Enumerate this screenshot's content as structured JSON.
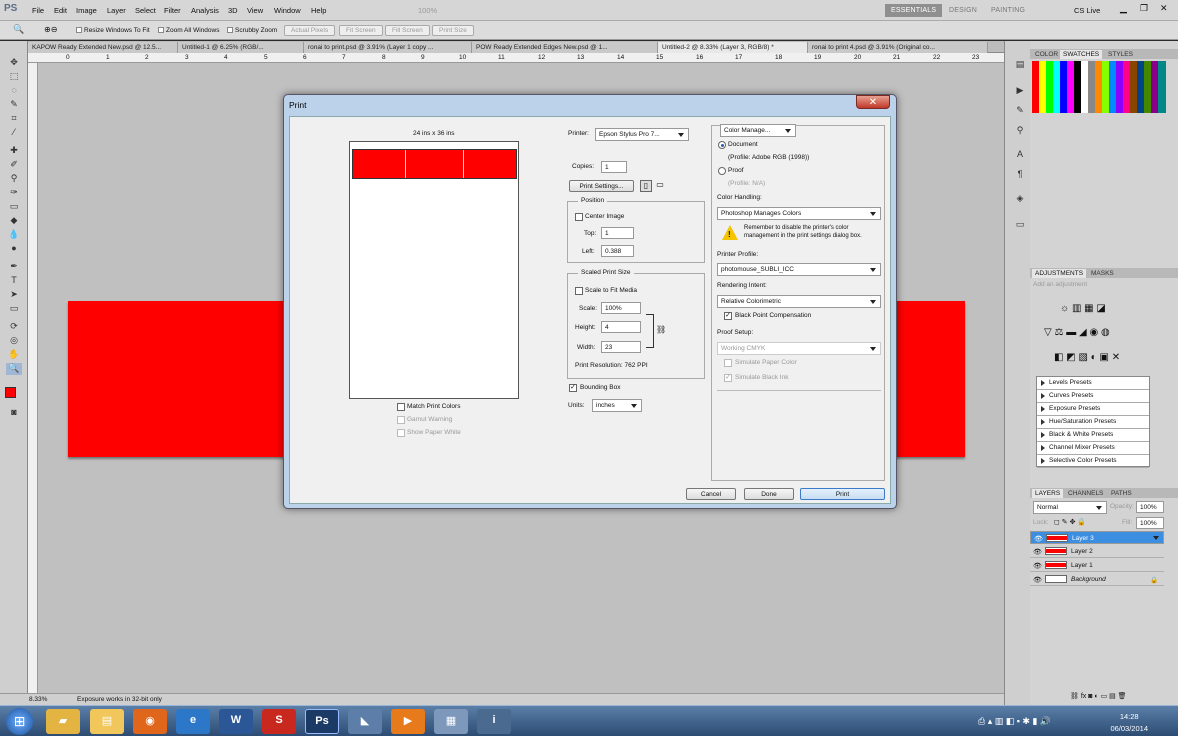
{
  "app": {
    "logo": "PS",
    "menu": [
      "File",
      "Edit",
      "Image",
      "Layer",
      "Select",
      "Filter",
      "Analysis",
      "3D",
      "View",
      "Window",
      "Help"
    ],
    "zoom_combo": "100%",
    "workspaces": [
      "ESSENTIALS",
      "DESIGN",
      "PAINTING"
    ],
    "cs_live": "CS Live"
  },
  "options_bar": {
    "resize_windows": "Resize Windows To Fit",
    "zoom_all": "Zoom All Windows",
    "scrubby_zoom": "Scrubby Zoom",
    "buttons": [
      "Actual Pixels",
      "Fit Screen",
      "Fill Screen",
      "Print Size"
    ]
  },
  "doc_tabs": [
    "KAPOW Ready Extended New.psd @ 12.5...",
    "Untitled-1 @ 6.25% (RGB/...",
    "ronai to print.psd @ 3.91% (Layer 1 copy ...",
    "POW Ready Extended Edges New.psd @ 1...",
    "Untitled-2 @ 8.33% (Layer 3, RGB/8) *",
    "ronai to print 4.psd @ 3.91% (Original co..."
  ],
  "ruler_ticks": [
    "0",
    "1",
    "2",
    "3",
    "4",
    "5",
    "6",
    "7",
    "8",
    "9",
    "10",
    "11",
    "12",
    "13",
    "14",
    "15",
    "16",
    "17",
    "18",
    "19",
    "20",
    "21",
    "22",
    "23"
  ],
  "status": {
    "zoom": "8.33%",
    "message": "Exposure works in 32-bit only"
  },
  "dialog": {
    "title": "Print",
    "page_size": "24 ins x 36 ins",
    "printer_label": "Printer:",
    "printer_value": "Epson Stylus Pro 7...",
    "copies_label": "Copies:",
    "copies_value": "1",
    "print_settings": "Print Settings...",
    "position": {
      "title": "Position",
      "center_image": "Center Image",
      "top_label": "Top:",
      "top_value": "1",
      "left_label": "Left:",
      "left_value": "0.388"
    },
    "scaled": {
      "title": "Scaled Print Size",
      "scale_to_fit": "Scale to Fit Media",
      "scale_label": "Scale:",
      "scale_value": "100%",
      "height_label": "Height:",
      "height_value": "4",
      "width_label": "Width:",
      "width_value": "23",
      "resolution": "Print Resolution: 762 PPI"
    },
    "bounding_box": "Bounding Box",
    "units_label": "Units:",
    "units_value": "inches",
    "match_print_colors": "Match Print Colors",
    "gamut_warning": "Gamut Warning",
    "show_paper_white": "Show Paper White",
    "color_mgmt": {
      "dropdown": "Color Manage...",
      "document": "Document",
      "document_profile": "(Profile: Adobe RGB (1998))",
      "proof": "Proof",
      "proof_profile": "(Profile: N/A)",
      "color_handling_label": "Color Handling:",
      "color_handling_value": "Photoshop Manages Colors",
      "warning": "Remember to disable the printer's color management in the print settings dialog box.",
      "printer_profile_label": "Printer Profile:",
      "printer_profile_value": "photomouse_SUBLI_ICC",
      "rendering_intent_label": "Rendering Intent:",
      "rendering_intent_value": "Relative Colorimetric",
      "black_point": "Black Point Compensation",
      "proof_setup_label": "Proof Setup:",
      "proof_setup_value": "Working CMYK",
      "simulate_paper": "Simulate Paper Color",
      "simulate_black": "Simulate Black Ink"
    },
    "buttons": {
      "cancel": "Cancel",
      "done": "Done",
      "print": "Print"
    }
  },
  "panels": {
    "color_tabs": [
      "COLOR",
      "SWATCHES",
      "STYLES"
    ],
    "adjust_tabs": [
      "ADJUSTMENTS",
      "MASKS"
    ],
    "adjust_hint": "Add an adjustment",
    "presets": [
      "Levels Presets",
      "Curves Presets",
      "Exposure Presets",
      "Hue/Saturation Presets",
      "Black & White Presets",
      "Channel Mixer Presets",
      "Selective Color Presets"
    ],
    "layer_tabs": [
      "LAYERS",
      "CHANNELS",
      "PATHS"
    ],
    "blend_mode": "Normal",
    "opacity_label": "Opacity:",
    "opacity_value": "100%",
    "lock_label": "Lock:",
    "fill_label": "Fill:",
    "fill_value": "100%",
    "layers": [
      "Layer 3",
      "Layer 2",
      "Layer 1",
      "Background"
    ]
  },
  "taskbar": {
    "time": "14:28",
    "date": "06/03/2014"
  }
}
